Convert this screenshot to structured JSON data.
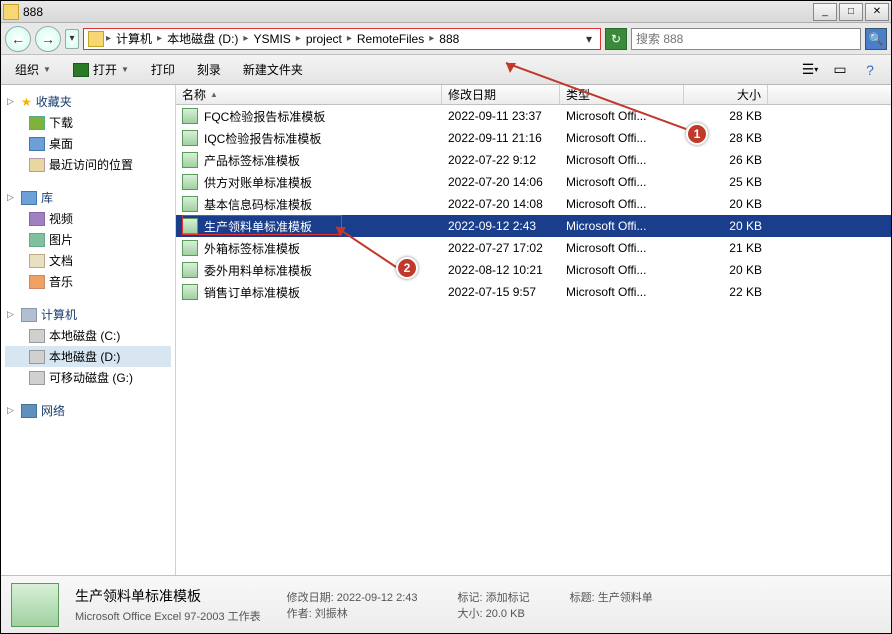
{
  "window": {
    "title": "888"
  },
  "breadcrumb": [
    "计算机",
    "本地磁盘 (D:)",
    "YSMIS",
    "project",
    "RemoteFiles",
    "888"
  ],
  "search": {
    "placeholder": "搜索 888"
  },
  "toolbar": {
    "organize": "组织",
    "open": "打开",
    "print": "打印",
    "burn": "刻录",
    "newfolder": "新建文件夹"
  },
  "columns": {
    "name": "名称",
    "date": "修改日期",
    "type": "类型",
    "size": "大小"
  },
  "sidebar": {
    "fav": {
      "label": "收藏夹",
      "items": [
        {
          "label": "下载",
          "icon": "ic-dl"
        },
        {
          "label": "桌面",
          "icon": "ic-desk"
        },
        {
          "label": "最近访问的位置",
          "icon": "ic-recent"
        }
      ]
    },
    "lib": {
      "label": "库",
      "items": [
        {
          "label": "视频",
          "icon": "ic-vid"
        },
        {
          "label": "图片",
          "icon": "ic-pic"
        },
        {
          "label": "文档",
          "icon": "ic-doc"
        },
        {
          "label": "音乐",
          "icon": "ic-mus"
        }
      ]
    },
    "pc": {
      "label": "计算机",
      "items": [
        {
          "label": "本地磁盘 (C:)",
          "icon": "ic-drive",
          "selected": false
        },
        {
          "label": "本地磁盘 (D:)",
          "icon": "ic-drive",
          "selected": true
        },
        {
          "label": "可移动磁盘 (G:)",
          "icon": "ic-drive",
          "selected": false
        }
      ]
    },
    "net": {
      "label": "网络"
    }
  },
  "files": [
    {
      "name": "FQC检验报告标准模板",
      "date": "2022-09-11 23:37",
      "type": "Microsoft Offi...",
      "size": "28 KB",
      "selected": false
    },
    {
      "name": "IQC检验报告标准模板",
      "date": "2022-09-11 21:16",
      "type": "Microsoft Offi...",
      "size": "28 KB",
      "selected": false
    },
    {
      "name": "产品标签标准模板",
      "date": "2022-07-22 9:12",
      "type": "Microsoft Offi...",
      "size": "26 KB",
      "selected": false
    },
    {
      "name": "供方对账单标准模板",
      "date": "2022-07-20 14:06",
      "type": "Microsoft Offi...",
      "size": "25 KB",
      "selected": false
    },
    {
      "name": "基本信息码标准模板",
      "date": "2022-07-20 14:08",
      "type": "Microsoft Offi...",
      "size": "20 KB",
      "selected": false
    },
    {
      "name": "生产领料单标准模板",
      "date": "2022-09-12 2:43",
      "type": "Microsoft Offi...",
      "size": "20 KB",
      "selected": true
    },
    {
      "name": "外箱标签标准模板",
      "date": "2022-07-27 17:02",
      "type": "Microsoft Offi...",
      "size": "21 KB",
      "selected": false
    },
    {
      "name": "委外用料单标准模板",
      "date": "2022-08-12 10:21",
      "type": "Microsoft Offi...",
      "size": "20 KB",
      "selected": false
    },
    {
      "name": "销售订单标准模板",
      "date": "2022-07-15 9:57",
      "type": "Microsoft Offi...",
      "size": "22 KB",
      "selected": false
    }
  ],
  "details": {
    "title": "生产领料单标准模板",
    "subtype": "Microsoft Office Excel 97-2003 工作表",
    "modLabel": "修改日期:",
    "modVal": "2022-09-12 2:43",
    "authorLabel": "作者:",
    "authorVal": "刘振林",
    "tagLabel": "标记:",
    "tagVal": "添加标记",
    "sizeLabel": "大小:",
    "sizeVal": "20.0 KB",
    "titleLabel": "标题:",
    "titleVal": "生产领料单"
  },
  "callouts": {
    "c1": "1",
    "c2": "2"
  }
}
